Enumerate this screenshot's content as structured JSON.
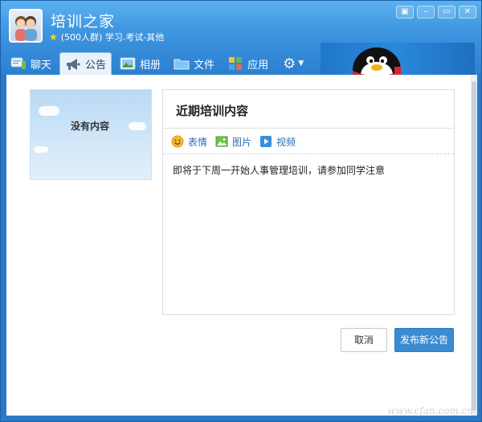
{
  "header": {
    "group_name": "培训之家",
    "group_info": "(500人群) 学习.考试-其他",
    "star_color": "#ffd23a"
  },
  "window_controls": [
    {
      "icon": "pin-icon",
      "glyph": "▣"
    },
    {
      "icon": "minimize-icon",
      "glyph": "–"
    },
    {
      "icon": "maximize-icon",
      "glyph": "▭"
    },
    {
      "icon": "close-icon",
      "glyph": "✕"
    }
  ],
  "tabs": [
    {
      "label": "聊天",
      "icon": "chat-icon",
      "active": false
    },
    {
      "label": "公告",
      "icon": "megaphone-icon",
      "active": true
    },
    {
      "label": "相册",
      "icon": "album-icon",
      "active": false
    },
    {
      "label": "文件",
      "icon": "folder-icon",
      "active": false
    },
    {
      "label": "应用",
      "icon": "apps-icon",
      "active": false
    }
  ],
  "sidebar_card": {
    "empty_text": "没有内容"
  },
  "editor": {
    "title": "近期培训内容",
    "toolbar": [
      {
        "label": "表情",
        "icon": "emoji-icon"
      },
      {
        "label": "图片",
        "icon": "image-icon"
      },
      {
        "label": "视频",
        "icon": "video-icon"
      }
    ],
    "body": "即将于下周一开始人事管理培训，请参加同学注意"
  },
  "actions": {
    "cancel_label": "取消",
    "publish_label": "发布新公告"
  },
  "watermark": "www.cfan.com.cn",
  "colors": {
    "titlebar": "#3f96e0",
    "accent_button": "#3b8bd3",
    "link_text": "#2a6fb0"
  }
}
